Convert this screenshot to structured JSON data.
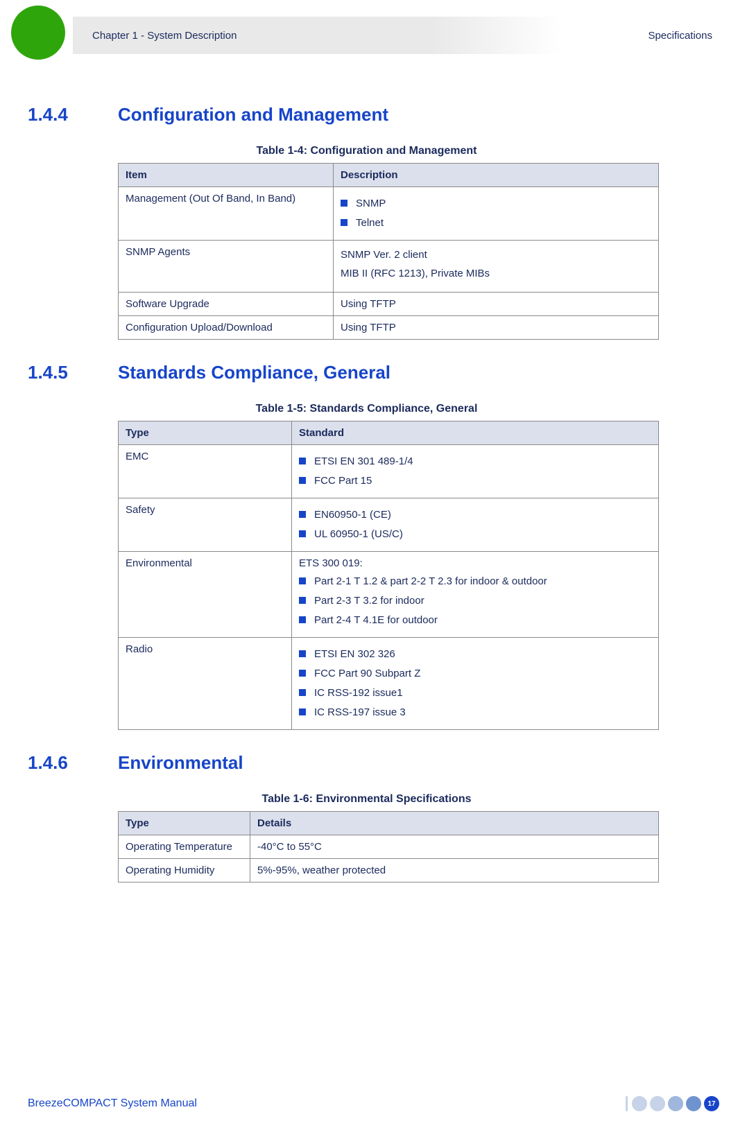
{
  "header": {
    "chapter": "Chapter 1 - System Description",
    "section": "Specifications"
  },
  "sections": [
    {
      "num": "1.4.4",
      "title": "Configuration and Management",
      "caption": "Table 1-4: Configuration and Management",
      "cols": [
        "Item",
        "Description"
      ],
      "rows": [
        {
          "c1": "Management (Out Of Band, In Band)",
          "bullets": [
            "SNMP",
            "Telnet"
          ]
        },
        {
          "c1": "SNMP Agents",
          "lines": [
            "SNMP Ver. 2 client",
            "MIB II (RFC 1213), Private MIBs"
          ]
        },
        {
          "c1": "Software Upgrade",
          "text": "Using TFTP"
        },
        {
          "c1": "Configuration Upload/Download",
          "text": "Using TFTP"
        }
      ]
    },
    {
      "num": "1.4.5",
      "title": "Standards Compliance, General",
      "caption": "Table 1-5: Standards Compliance, General",
      "cols": [
        "Type",
        "Standard"
      ],
      "rows": [
        {
          "c1": "EMC",
          "bullets": [
            "ETSI EN 301 489-1/4",
            "FCC Part 15"
          ]
        },
        {
          "c1": "Safety",
          "bullets": [
            "EN60950-1 (CE)",
            "UL 60950-1 (US/C)"
          ]
        },
        {
          "c1": "Environmental",
          "pretext": "ETS 300 019:",
          "bullets": [
            "Part 2-1 T 1.2 & part 2-2 T 2.3 for indoor & outdoor",
            "Part 2-3 T 3.2 for indoor",
            "Part 2-4 T 4.1E for outdoor"
          ]
        },
        {
          "c1": "Radio",
          "bullets": [
            "ETSI EN 302 326",
            "FCC Part 90 Subpart Z",
            "IC RSS-192 issue1",
            "IC RSS-197 issue 3"
          ]
        }
      ]
    },
    {
      "num": "1.4.6",
      "title": "Environmental",
      "caption": "Table 1-6: Environmental Specifications",
      "cols": [
        "Type",
        "Details"
      ],
      "rows": [
        {
          "c1": "Operating Temperature",
          "text": "-40°C to 55°C"
        },
        {
          "c1": "Operating Humidity",
          "text": "5%-95%, weather protected"
        }
      ]
    }
  ],
  "footer": {
    "manual": "BreezeCOMPACT System Manual",
    "page": "17"
  }
}
